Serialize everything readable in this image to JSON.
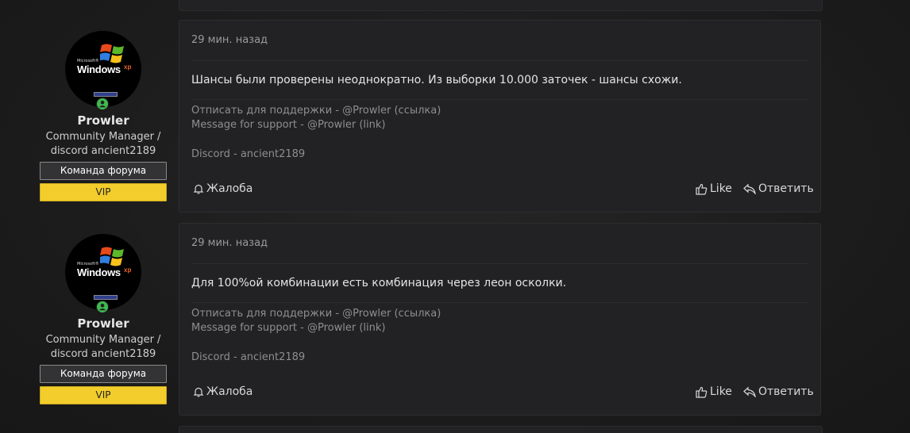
{
  "posts": [
    {
      "user": {
        "avatar_label_small": "Microsoft®",
        "avatar_label": "Windows",
        "avatar_label_sup": "xp",
        "name": "Prowler",
        "title_line1": "Community Manager /",
        "title_line2": "discord ancient2189",
        "badge_team": "Команда форума",
        "badge_vip": "VIP"
      },
      "time": "29 мин. назад",
      "message": "Шансы были проверены неоднократно. Из выборки 10.000 заточек - шансы схожи.",
      "signature": {
        "line1": "Отписать для поддержки - @Prowler (ссылка)",
        "line2": "Message for support - @Prowler (link)",
        "line3": "Discord - ancient2189"
      },
      "actions": {
        "report": "Жалоба",
        "like": "Like",
        "reply": "Ответить"
      }
    },
    {
      "user": {
        "avatar_label_small": "Microsoft®",
        "avatar_label": "Windows",
        "avatar_label_sup": "xp",
        "name": "Prowler",
        "title_line1": "Community Manager /",
        "title_line2": "discord ancient2189",
        "badge_team": "Команда форума",
        "badge_vip": "VIP"
      },
      "time": "29 мин. назад",
      "message": "Для 100%ой комбинации есть комбинация через леон осколки.",
      "signature": {
        "line1": "Отписать для поддержки - @Prowler (ссылка)",
        "line2": "Message for support - @Prowler (link)",
        "line3": "Discord - ancient2189"
      },
      "actions": {
        "report": "Жалоба",
        "like": "Like",
        "reply": "Ответить"
      }
    }
  ],
  "colors": {
    "background": "#1b1b1b",
    "card": "#222224",
    "vip_badge": "#f2cd2b",
    "online_indicator": "#3fb950"
  },
  "icons": {
    "report": "bell-icon",
    "like": "thumbs-up-icon",
    "reply": "reply-arrow-icon",
    "online": "user-online-icon"
  }
}
